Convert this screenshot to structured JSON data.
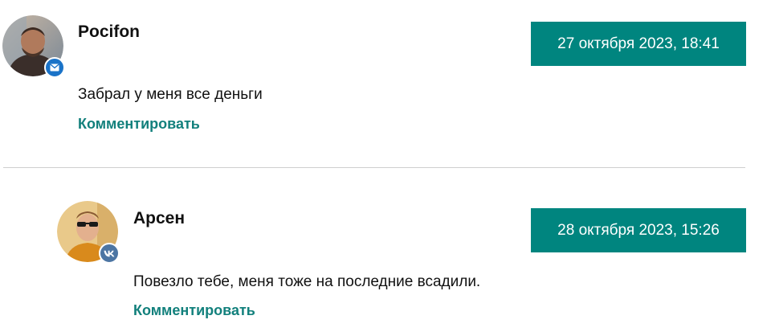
{
  "colors": {
    "accent": "#00857f",
    "link": "#12807c",
    "divider": "#cfcfcf",
    "mail_badge": "#1a73c8",
    "vk_badge": "#4c75a3"
  },
  "comments": [
    {
      "author": "Pocifon",
      "date": "27 октября 2023, 18:41",
      "text": "Забрал у меня все деньги",
      "reply_label": "Комментировать",
      "badge_icon": "mail-icon"
    },
    {
      "author": "Арсен",
      "date": "28 октября 2023, 15:26",
      "text": "Повезло тебе, меня тоже на последние всадили.",
      "reply_label": "Комментировать",
      "badge_icon": "vk-icon"
    }
  ]
}
